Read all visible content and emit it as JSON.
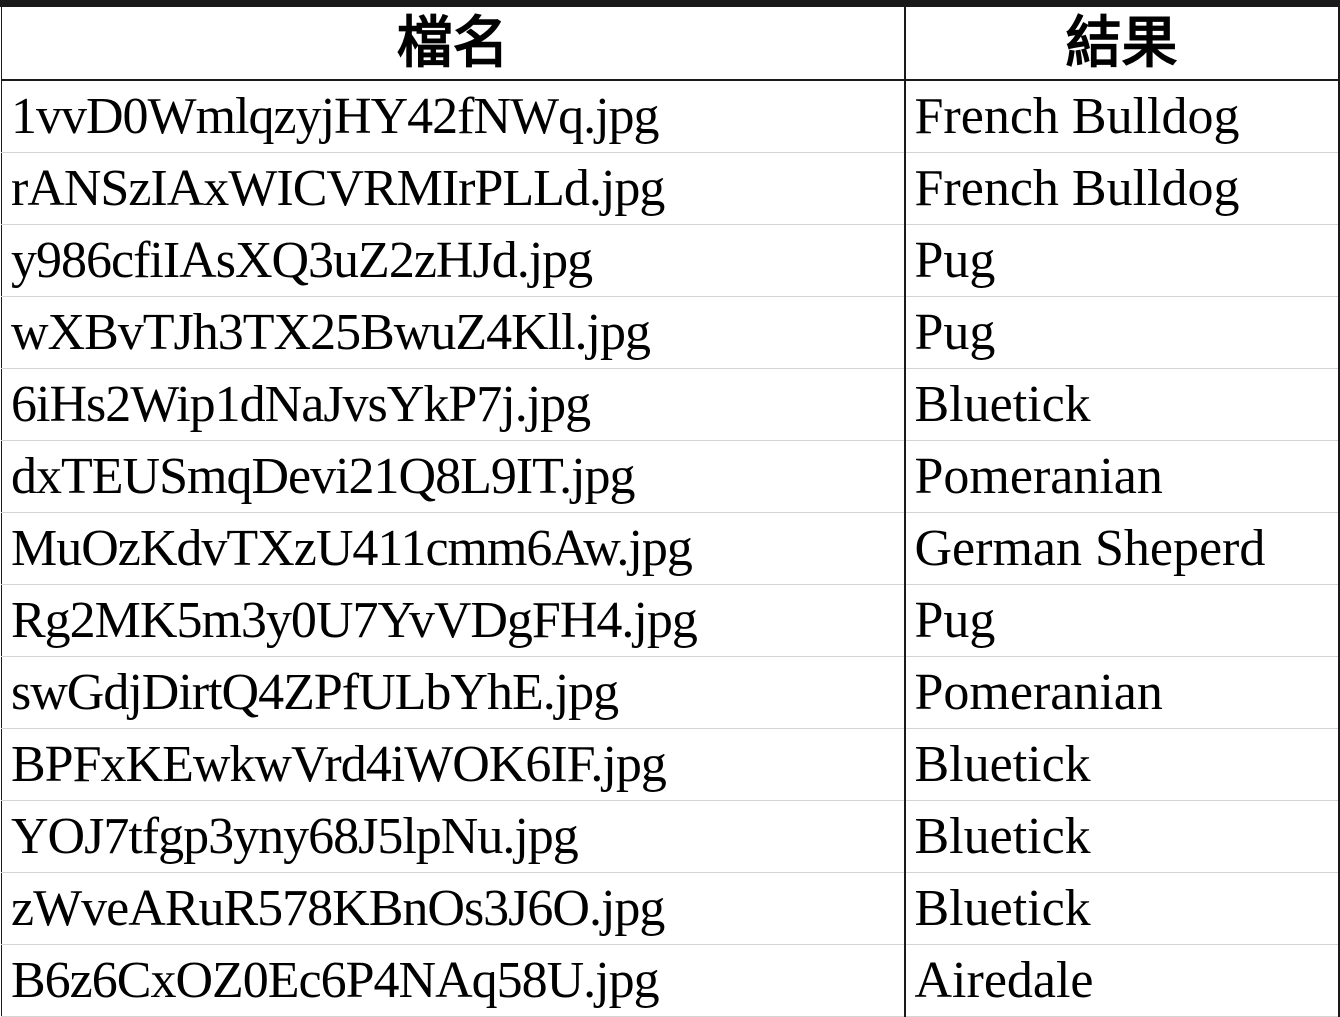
{
  "sheet": {
    "headers": {
      "name": "檔名",
      "result": "結果"
    },
    "rows": [
      {
        "file": "1vvD0WmlqzyjHY42fNWq.jpg",
        "result": "French Bulldog"
      },
      {
        "file": "rANSzIAxWICVRMIrPLLd.jpg",
        "result": "French Bulldog"
      },
      {
        "file": "y986cfiIAsXQ3uZ2zHJd.jpg",
        "result": "Pug"
      },
      {
        "file": "wXBvTJh3TX25BwuZ4Kll.jpg",
        "result": "Pug"
      },
      {
        "file": "6iHs2Wip1dNaJvsYkP7j.jpg",
        "result": "Bluetick"
      },
      {
        "file": "dxTEUSmqDevi21Q8L9IT.jpg",
        "result": "Pomeranian"
      },
      {
        "file": "MuOzKdvTXzU411cmm6Aw.jpg",
        "result": "German Sheperd"
      },
      {
        "file": "Rg2MK5m3y0U7YvVDgFH4.jpg",
        "result": "Pug"
      },
      {
        "file": "swGdjDirtQ4ZPfULbYhE.jpg",
        "result": "Pomeranian"
      },
      {
        "file": "BPFxKEwkwVrd4iWOK6IF.jpg",
        "result": "Bluetick"
      },
      {
        "file": "YOJ7tfgp3yny68J5lpNu.jpg",
        "result": "Bluetick"
      },
      {
        "file": "zWveARuR578KBnOs3J6O.jpg",
        "result": "Bluetick"
      },
      {
        "file": "B6z6CxOZ0Ec6P4NAq58U.jpg",
        "result": "Airedale"
      }
    ]
  }
}
